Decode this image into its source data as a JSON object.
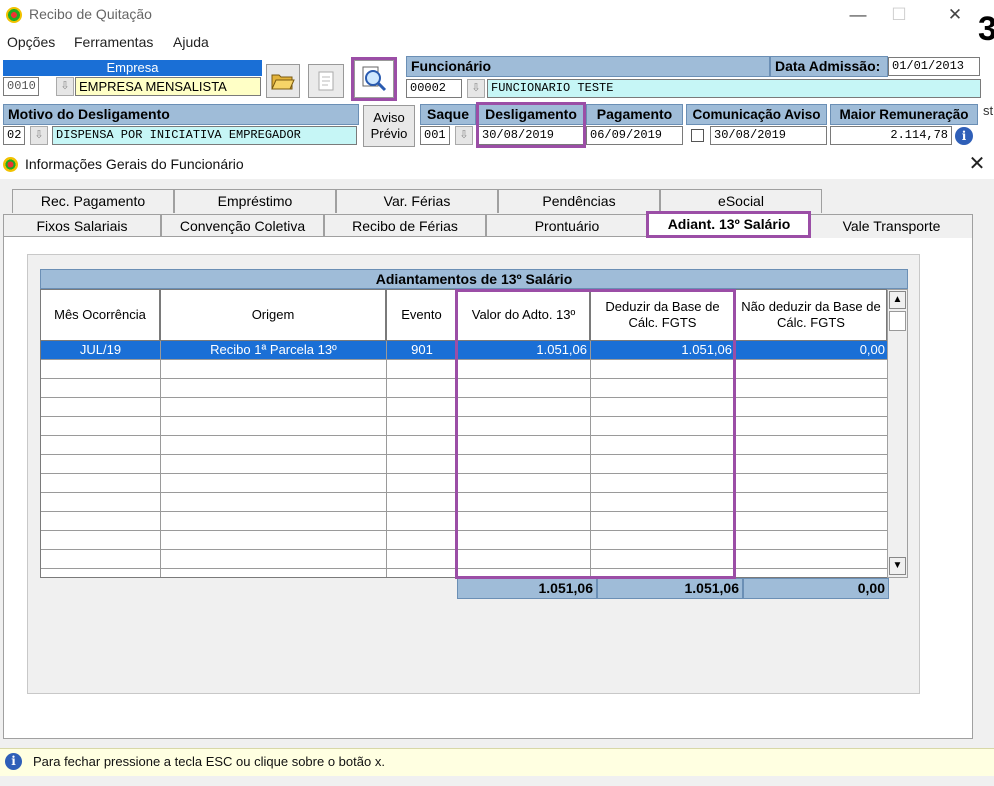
{
  "window": {
    "title": "Recibo de Quitação",
    "min": "—",
    "max": "☐",
    "close": "✕"
  },
  "menu": [
    "Opções",
    "Ferramentas",
    "Ajuda"
  ],
  "empresa": {
    "label": "Empresa",
    "code": "0010",
    "name": "EMPRESA MENSALISTA"
  },
  "funcionario": {
    "label": "Funcionário",
    "code": "00002",
    "name": "FUNCIONARIO TESTE"
  },
  "admissao": {
    "label": "Data Admissão:",
    "value": "01/01/2013"
  },
  "motivo": {
    "label": "Motivo do Desligamento",
    "code": "02",
    "value": "DISPENSA POR INICIATIVA EMPREGADOR"
  },
  "aviso_previo": {
    "line1": "Aviso",
    "line2": "Prévio"
  },
  "saque": {
    "label": "Saque",
    "value": "001"
  },
  "desligamento": {
    "label": "Desligamento",
    "value": "30/08/2019"
  },
  "pagamento": {
    "label": "Pagamento",
    "value": "06/09/2019"
  },
  "comunicacao": {
    "label": "Comunicação Aviso",
    "value": "30/08/2019"
  },
  "maior_remuneracao": {
    "label": "Maior Remuneração",
    "value": "2.114,78"
  },
  "edge_fragment": {
    "big": "3",
    "small": "st"
  },
  "dialog": {
    "title": "Informações Gerais do Funcionário",
    "close": "✕",
    "tabs_back": [
      "Rec. Pagamento",
      "Empréstimo",
      "Var. Férias",
      "Pendências",
      "eSocial"
    ],
    "tabs_front": [
      "Fixos Salariais",
      "Convenção Coletiva",
      "Recibo de Férias",
      "Prontuário",
      "Adiant. 13º Salário",
      "Vale Transporte"
    ]
  },
  "grid": {
    "caption": "Adiantamentos de 13º Salário",
    "columns": [
      "Mês Ocorrência",
      "Origem",
      "Evento",
      "Valor do Adto. 13º",
      "Deduzir da Base de Cálc. FGTS",
      "Não deduzir da Base de Cálc. FGTS"
    ],
    "rows": [
      {
        "mes": "JUL/19",
        "origem": "Recibo 1ª Parcela 13º",
        "evento": "901",
        "valor": "1.051,06",
        "deduzir": "1.051,06",
        "nao_deduzir": "0,00"
      }
    ],
    "totals": {
      "valor": "1.051,06",
      "deduzir": "1.051,06",
      "nao_deduzir": "0,00"
    }
  },
  "status": {
    "text": "Para fechar pressione a tecla ESC ou clique sobre o botão x."
  },
  "colors": {
    "accent_purple": "#9b4ea6",
    "header_blue": "#9fbcd8",
    "selection_blue": "#1a6fd6",
    "field_cyan": "#c6f6f6",
    "field_yellow": "#ffffc6"
  }
}
